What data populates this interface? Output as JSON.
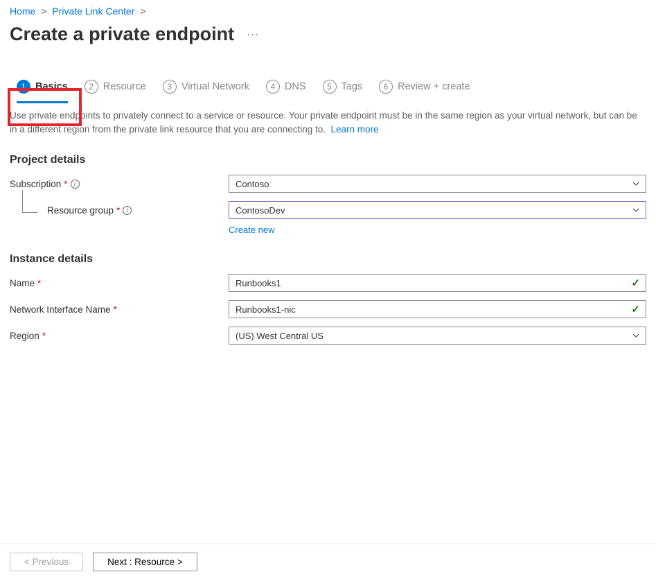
{
  "breadcrumb": {
    "items": [
      "Home",
      "Private Link Center"
    ]
  },
  "page": {
    "title": "Create a private endpoint"
  },
  "tabs": [
    {
      "num": "1",
      "label": "Basics"
    },
    {
      "num": "2",
      "label": "Resource"
    },
    {
      "num": "3",
      "label": "Virtual Network"
    },
    {
      "num": "4",
      "label": "DNS"
    },
    {
      "num": "5",
      "label": "Tags"
    },
    {
      "num": "6",
      "label": "Review + create"
    }
  ],
  "intro": {
    "text": "Use private endpoints to privately connect to a service or resource. Your private endpoint must be in the same region as your virtual network, but can be in a different region from the private link resource that you are connecting to.",
    "learn_more": "Learn more"
  },
  "sections": {
    "project": {
      "title": "Project details",
      "subscription_label": "Subscription",
      "subscription_value": "Contoso",
      "rg_label": "Resource group",
      "rg_value": "ContosoDev",
      "create_new": "Create new"
    },
    "instance": {
      "title": "Instance details",
      "name_label": "Name",
      "name_value": "Runbooks1",
      "nic_label": "Network Interface Name",
      "nic_value": "Runbooks1-nic",
      "region_label": "Region",
      "region_value": "(US) West Central US"
    }
  },
  "footer": {
    "previous": "< Previous",
    "next": "Next : Resource >"
  }
}
